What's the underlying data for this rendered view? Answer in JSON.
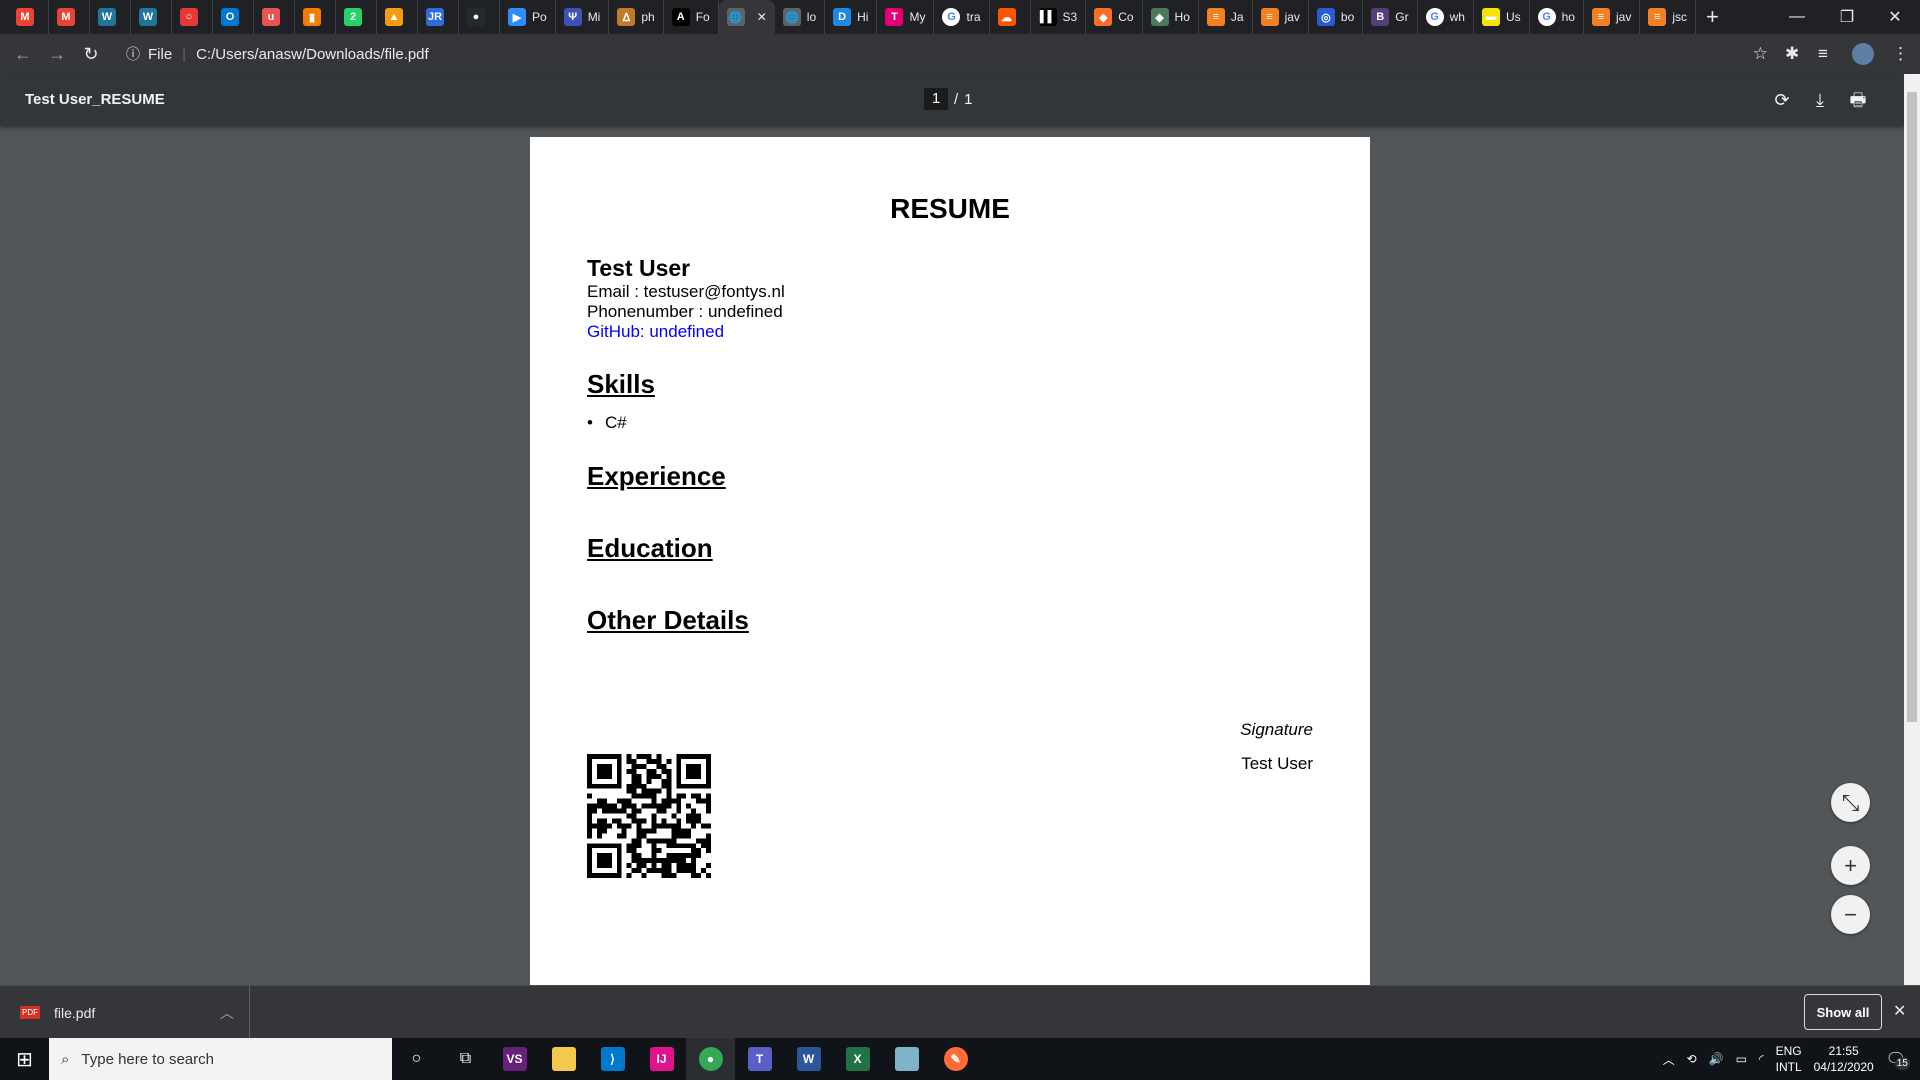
{
  "tabs": [
    {
      "label": "",
      "icon": "gmail-icon",
      "color": "#ea4335",
      "glyph": "M"
    },
    {
      "label": "",
      "icon": "gmail-icon",
      "color": "#ea4335",
      "glyph": "M"
    },
    {
      "label": "",
      "icon": "wordpress-icon",
      "color": "#21759b",
      "glyph": "W"
    },
    {
      "label": "",
      "icon": "wordpress-icon",
      "color": "#21759b",
      "glyph": "W"
    },
    {
      "label": "",
      "icon": "circle-icon",
      "color": "#e53935",
      "glyph": "○"
    },
    {
      "label": "",
      "icon": "outlook-icon",
      "color": "#0078d4",
      "glyph": "O"
    },
    {
      "label": "",
      "icon": "udemy-icon",
      "color": "#ec5252",
      "glyph": "u"
    },
    {
      "label": "",
      "icon": "app-icon",
      "color": "#f57c00",
      "glyph": "▮"
    },
    {
      "label": "",
      "icon": "whatsapp-icon",
      "color": "#25d366",
      "glyph": "2"
    },
    {
      "label": "",
      "icon": "diagram-icon",
      "color": "#f39c12",
      "glyph": "▲"
    },
    {
      "label": "",
      "icon": "jr-icon",
      "color": "#2d6cdf",
      "glyph": "JR"
    },
    {
      "label": "",
      "icon": "github-icon",
      "color": "#24292e",
      "glyph": "●"
    },
    {
      "label": "Po",
      "icon": "zoom-icon",
      "color": "#2d8cff",
      "glyph": "▶"
    },
    {
      "label": "Mi",
      "icon": "tree-icon",
      "color": "#3f51b5",
      "glyph": "Ψ"
    },
    {
      "label": "ph",
      "icon": "phar-icon",
      "color": "#c17a2a",
      "glyph": "ᐃ"
    },
    {
      "label": "Fo",
      "icon": "angular-icon",
      "color": "#000",
      "glyph": "A"
    },
    {
      "label": "",
      "icon": "globe-icon",
      "color": "#5f6368",
      "glyph": "🌐",
      "active": true
    },
    {
      "label": "lo",
      "icon": "globe-icon",
      "color": "#5f6368",
      "glyph": "🌐"
    },
    {
      "label": "Hi",
      "icon": "d-icon",
      "color": "#1e88e5",
      "glyph": "D"
    },
    {
      "label": "My",
      "icon": "telekom-icon",
      "color": "#e20074",
      "glyph": "T"
    },
    {
      "label": "tra",
      "icon": "google-icon",
      "color": "#fff",
      "glyph": "G"
    },
    {
      "label": "",
      "icon": "soundcloud-icon",
      "color": "#ff5500",
      "glyph": "☁"
    },
    {
      "label": "S3",
      "icon": "trello-icon",
      "color": "#000",
      "glyph": "▌▌"
    },
    {
      "label": "Co",
      "icon": "gitlab-icon",
      "color": "#fc6d26",
      "glyph": "◆"
    },
    {
      "label": "Ho",
      "icon": "badge-icon",
      "color": "#4a7a5a",
      "glyph": "◈"
    },
    {
      "label": "Ja",
      "icon": "stackoverflow-icon",
      "color": "#f48024",
      "glyph": "≡"
    },
    {
      "label": "jav",
      "icon": "stackoverflow-icon",
      "color": "#f48024",
      "glyph": "≡"
    },
    {
      "label": "bo",
      "icon": "blue-circle-icon",
      "color": "#2a5bd7",
      "glyph": "◎"
    },
    {
      "label": "Gr",
      "icon": "bootstrap-icon",
      "color": "#563d7c",
      "glyph": "B"
    },
    {
      "label": "wh",
      "icon": "google-icon",
      "color": "#fff",
      "glyph": "G"
    },
    {
      "label": "Us",
      "icon": "yellow-icon",
      "color": "#f4e400",
      "glyph": "▬"
    },
    {
      "label": "ho",
      "icon": "google-icon",
      "color": "#fff",
      "glyph": "G"
    },
    {
      "label": "jav",
      "icon": "stackoverflow-icon",
      "color": "#f48024",
      "glyph": "≡"
    },
    {
      "label": "jsc",
      "icon": "stackoverflow-icon",
      "color": "#f48024",
      "glyph": "≡"
    }
  ],
  "address": {
    "scheme_label": "File",
    "url": "C:/Users/anasw/Downloads/file.pdf"
  },
  "pdf": {
    "title": "Test User_RESUME",
    "current_page": "1",
    "separator": "/",
    "total_pages": "1"
  },
  "resume": {
    "heading": "RESUME",
    "name": "Test User",
    "email": "Email : testuser@fontys.nl",
    "phone": "Phonenumber : undefined",
    "github": "GitHub: undefined",
    "github_color": "#0000ff",
    "skills_heading": "Skills",
    "skills": [
      "C#"
    ],
    "experience_heading": "Experience",
    "education_heading": "Education",
    "other_heading": "Other Details",
    "signature_label": "Signature",
    "signature_name": "Test User"
  },
  "downloads": {
    "file": "file.pdf",
    "show_all": "Show all"
  },
  "taskbar": {
    "search_placeholder": "Type here to search",
    "lang1": "ENG",
    "lang2": "INTL",
    "time": "21:55",
    "date": "04/12/2020",
    "notifications": "15"
  }
}
